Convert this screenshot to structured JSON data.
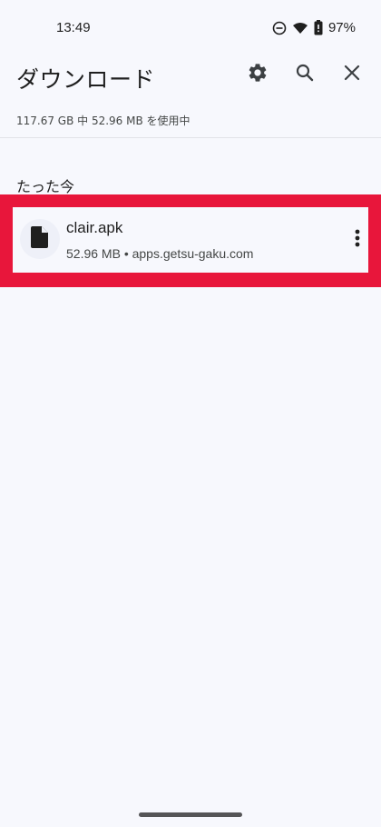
{
  "status_bar": {
    "time": "13:49",
    "battery_percent": "97%",
    "icons": [
      "do-not-disturb-icon",
      "wifi-icon",
      "battery-icon"
    ]
  },
  "header": {
    "title": "ダウンロード",
    "actions": [
      "settings-icon",
      "search-icon",
      "close-icon"
    ]
  },
  "storage": {
    "text": "117.67 GB 中 52.96 MB を使用中"
  },
  "sections": [
    {
      "header": "たった今",
      "items": [
        {
          "file_name": "clair.apk",
          "meta": "52.96 MB • apps.getsu-gaku.com",
          "icon": "file-icon",
          "menu_icon": "more-vert-icon"
        }
      ]
    }
  ],
  "colors": {
    "background": "#f7f8fd",
    "highlight": "#e8163b",
    "text_primary": "#1f1f1f",
    "text_secondary": "#444746"
  }
}
